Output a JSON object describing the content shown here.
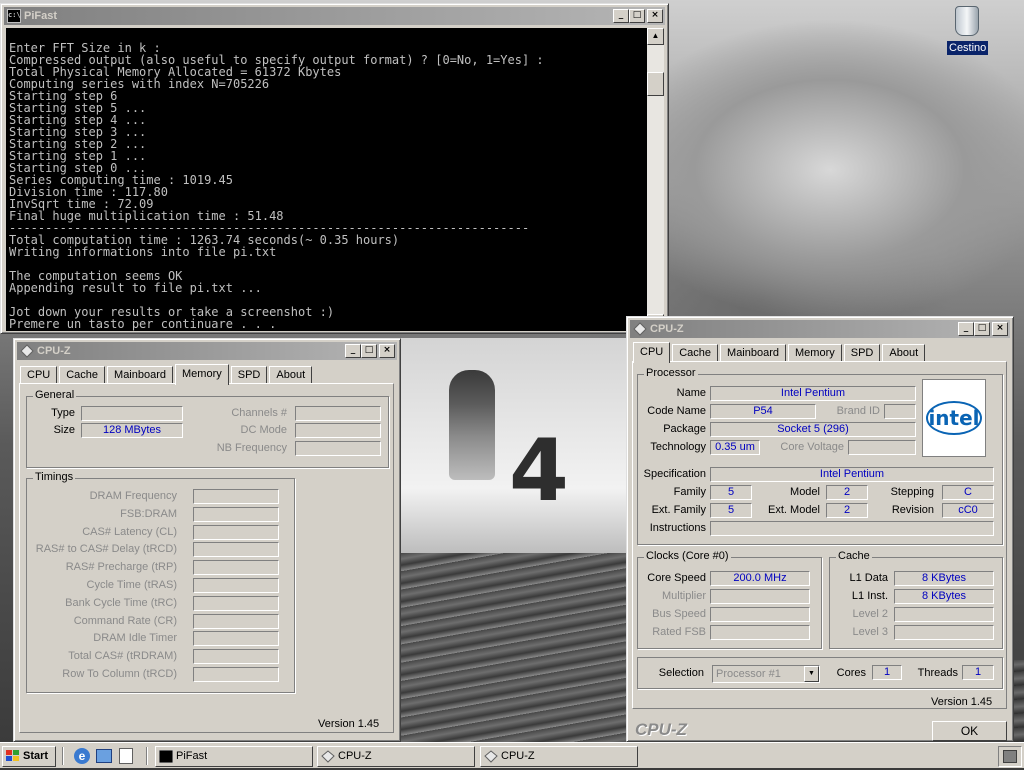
{
  "desktop": {
    "trash_label": "Cestino"
  },
  "pifast": {
    "title": "PiFast",
    "lines": [
      "Enter FFT Size in k :",
      "Compressed output (also useful to specify output format) ? [0=No, 1=Yes] :",
      "Total Physical Memory Allocated = 61372 Kbytes",
      "Computing series with index N=705226",
      "Starting step 6",
      "Starting step 5 ...",
      "Starting step 4 ...",
      "Starting step 3 ...",
      "Starting step 2 ...",
      "Starting step 1 ...",
      "Starting step 0 ...",
      "Series computing time : 1019.45",
      "Division time : 117.80",
      "InvSqrt time : 72.09",
      "Final huge multiplication time : 51.48",
      "------------------------------------------------------------------------",
      "Total computation time : 1263.74 seconds(~ 0.35 hours)",
      "Writing informations into file pi.txt",
      "",
      "The computation seems OK",
      "Appending result to file pi.txt ...",
      "",
      "Jot down your results or take a screenshot :)",
      "Premere un tasto per continuare . . ."
    ]
  },
  "cpuz_mem": {
    "title": "CPU-Z",
    "tabs": [
      "CPU",
      "Cache",
      "Mainboard",
      "Memory",
      "SPD",
      "About"
    ],
    "active_tab": "Memory",
    "general": {
      "title": "General",
      "type_label": "Type",
      "type_value": "",
      "size_label": "Size",
      "size_value": "128 MBytes",
      "channels_label": "Channels #",
      "dc_mode_label": "DC Mode",
      "nb_freq_label": "NB Frequency"
    },
    "timings": {
      "title": "Timings",
      "rows": [
        "DRAM Frequency",
        "FSB:DRAM",
        "CAS# Latency (CL)",
        "RAS# to CAS# Delay (tRCD)",
        "RAS# Precharge (tRP)",
        "Cycle Time (tRAS)",
        "Bank Cycle Time (tRC)",
        "Command Rate (CR)",
        "DRAM Idle Timer",
        "Total CAS# (tRDRAM)",
        "Row To Column (tRCD)"
      ]
    },
    "version": "Version 1.45"
  },
  "cpuz_cpu": {
    "title": "CPU-Z",
    "tabs": [
      "CPU",
      "Cache",
      "Mainboard",
      "Memory",
      "SPD",
      "About"
    ],
    "active_tab": "CPU",
    "processor": {
      "title": "Processor",
      "name_label": "Name",
      "name": "Intel Pentium",
      "codename_label": "Code Name",
      "codename": "P54",
      "brandid_label": "Brand ID",
      "brandid": "",
      "package_label": "Package",
      "package": "Socket 5 (296)",
      "technology_label": "Technology",
      "technology": "0.35 um",
      "core_voltage_label": "Core Voltage",
      "core_voltage": "",
      "spec_label": "Specification",
      "spec": "Intel Pentium",
      "family_label": "Family",
      "family": "5",
      "model_label": "Model",
      "model": "2",
      "stepping_label": "Stepping",
      "stepping": "C",
      "extfamily_label": "Ext. Family",
      "extfamily": "5",
      "extmodel_label": "Ext. Model",
      "extmodel": "2",
      "revision_label": "Revision",
      "revision": "cC0",
      "instructions_label": "Instructions",
      "instructions": "",
      "logo_text": "intel"
    },
    "clocks": {
      "title": "Clocks (Core #0)",
      "core_speed_label": "Core Speed",
      "core_speed": "200.0 MHz",
      "multiplier_label": "Multiplier",
      "bus_speed_label": "Bus Speed",
      "rated_fsb_label": "Rated FSB"
    },
    "cache": {
      "title": "Cache",
      "l1data_label": "L1 Data",
      "l1data": "8 KBytes",
      "l1inst_label": "L1 Inst.",
      "l1inst": "8 KBytes",
      "level2_label": "Level 2",
      "level3_label": "Level 3"
    },
    "selection_label": "Selection",
    "selection_value": "Processor #1",
    "cores_label": "Cores",
    "cores": "1",
    "threads_label": "Threads",
    "threads": "1",
    "version": "Version 1.45",
    "brand": "CPU-Z",
    "ok_label": "OK"
  },
  "taskbar": {
    "start": "Start",
    "tasks": [
      "PiFast",
      "CPU-Z",
      "CPU-Z"
    ]
  },
  "colors": {
    "field_text": "#0000c0",
    "title_inactive": "#808080",
    "face": "#d4d0c8"
  }
}
